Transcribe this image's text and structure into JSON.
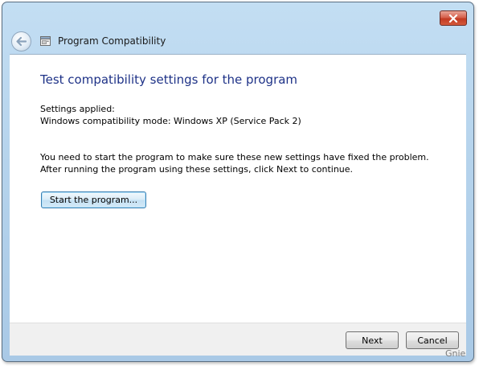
{
  "window": {
    "title": "Program Compatibility",
    "icons": {
      "back": "back-arrow-icon",
      "app": "program-compatibility-icon",
      "close": "close-x-icon"
    }
  },
  "main": {
    "heading": "Test compatibility settings for the program",
    "settings_label": "Settings applied:",
    "settings_value": "Windows compatibility mode: Windows XP (Service Pack 2)",
    "instructions": "You need to start the program to make sure these new settings have fixed the problem. After running the program using these settings, click Next to continue.",
    "start_button_label": "Start the program..."
  },
  "footer": {
    "next_label": "Next",
    "cancel_label": "Cancel"
  },
  "watermark": "Gnie",
  "colors": {
    "heading": "#1e3287",
    "frame": "#b5d3ec",
    "close_button": "#c23a22",
    "footer": "#f0f0f0"
  }
}
